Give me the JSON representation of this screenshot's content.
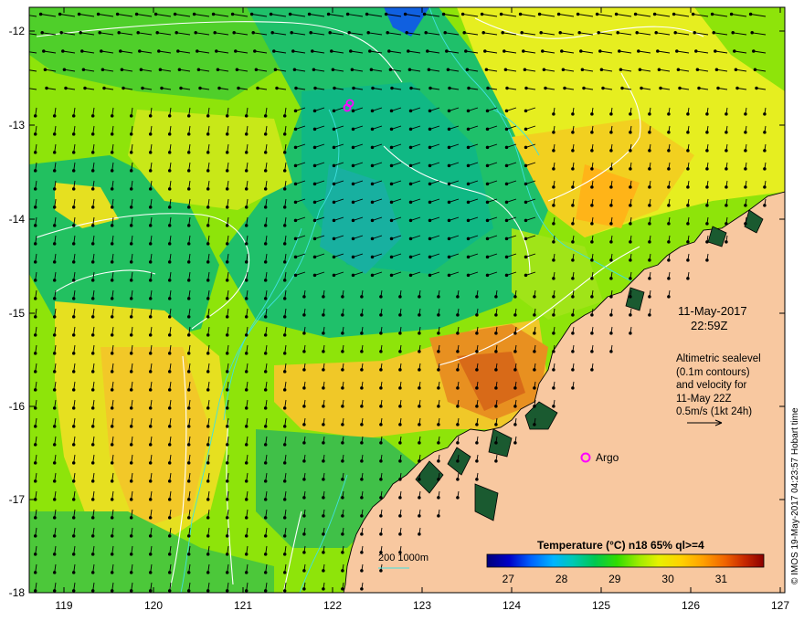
{
  "map": {
    "x_ticks": [
      "119",
      "120",
      "121",
      "122",
      "123",
      "124",
      "125",
      "126",
      "127"
    ],
    "y_ticks": [
      "-12",
      "-13",
      "-14",
      "-15",
      "-16",
      "-17",
      "-18"
    ],
    "date": "11-May-2017",
    "time": "22:59Z",
    "description_lines": [
      "Altimetric sealevel",
      "(0.1m contours)",
      "and velocity for",
      "11-May 22Z"
    ],
    "velocity_scale": "0.5m/s (1kt 24h)",
    "argo_label": "Argo",
    "bathymetry_label": "200  1000m",
    "credit": "© IMOS 19-May-2017 04:23:57 Hobart time"
  },
  "colorbar": {
    "title": "Temperature (°C) n18 65% ql>=4",
    "ticks": [
      "27",
      "28",
      "29",
      "30",
      "31"
    ],
    "range": [
      26.6,
      31.8
    ],
    "colors": [
      "#00007a",
      "#0000c8",
      "#0064ff",
      "#00b4ff",
      "#00c8b4",
      "#00c850",
      "#32dc00",
      "#a0ec00",
      "#e6f000",
      "#ffd200",
      "#ffa000",
      "#f06400",
      "#c82800",
      "#8c0000"
    ]
  },
  "colors": {
    "land": "#f8c8a0",
    "sea_contour": "#ffffff",
    "bathymetry": "#40e0e0",
    "argo_marker": "#ff00ff"
  }
}
